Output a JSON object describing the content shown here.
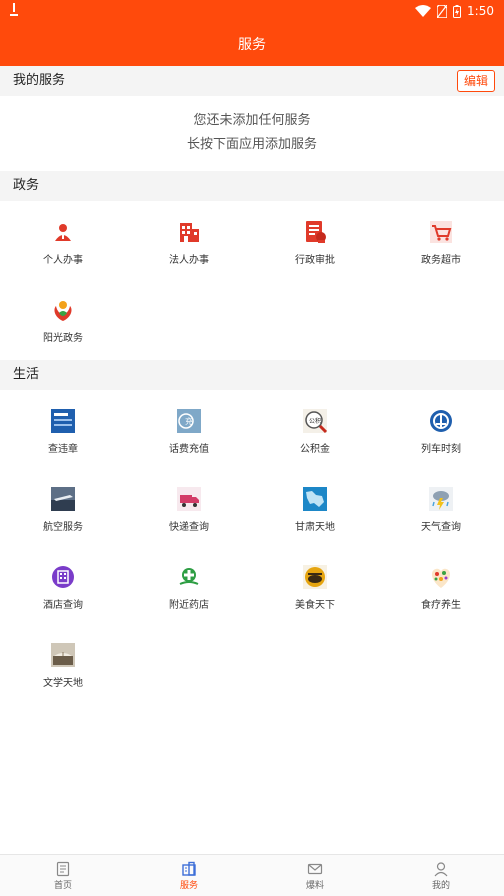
{
  "status": {
    "time": "1:50"
  },
  "header": {
    "title": "服务"
  },
  "my_services": {
    "title": "我的服务",
    "edit_label": "编辑",
    "empty_line1": "您还未添加任何服务",
    "empty_line2": "长按下面应用添加服务"
  },
  "gov": {
    "title": "政务",
    "items": [
      {
        "label": "个人办事",
        "icon": "person-icon"
      },
      {
        "label": "法人办事",
        "icon": "building-icon"
      },
      {
        "label": "行政审批",
        "icon": "document-approval-icon"
      },
      {
        "label": "政务超市",
        "icon": "shopping-cart-icon"
      },
      {
        "label": "阳光政务",
        "icon": "sunshine-gov-logo-icon"
      }
    ]
  },
  "life": {
    "title": "生活",
    "items": [
      {
        "label": "查违章",
        "icon": "traffic-violation-icon"
      },
      {
        "label": "话费充值",
        "icon": "phone-recharge-icon"
      },
      {
        "label": "公积金",
        "icon": "housing-fund-icon"
      },
      {
        "label": "列车时刻",
        "icon": "train-icon"
      },
      {
        "label": "航空服务",
        "icon": "airplane-icon"
      },
      {
        "label": "快递查询",
        "icon": "delivery-truck-icon"
      },
      {
        "label": "甘肃天地",
        "icon": "gansu-map-icon"
      },
      {
        "label": "天气查询",
        "icon": "weather-icon"
      },
      {
        "label": "酒店查询",
        "icon": "hotel-icon"
      },
      {
        "label": "附近药店",
        "icon": "pharmacy-icon"
      },
      {
        "label": "美食天下",
        "icon": "food-icon"
      },
      {
        "label": "食疗养生",
        "icon": "health-food-icon"
      },
      {
        "label": "文学天地",
        "icon": "books-icon"
      }
    ]
  },
  "bottom_nav": [
    {
      "label": "首页",
      "icon": "home-icon",
      "active": false
    },
    {
      "label": "服务",
      "icon": "service-icon",
      "active": true
    },
    {
      "label": "爆料",
      "icon": "mail-icon",
      "active": false
    },
    {
      "label": "我的",
      "icon": "profile-icon",
      "active": false
    }
  ],
  "colors": {
    "brand": "#ff4a0c",
    "section_bg": "#f4f4f4"
  }
}
